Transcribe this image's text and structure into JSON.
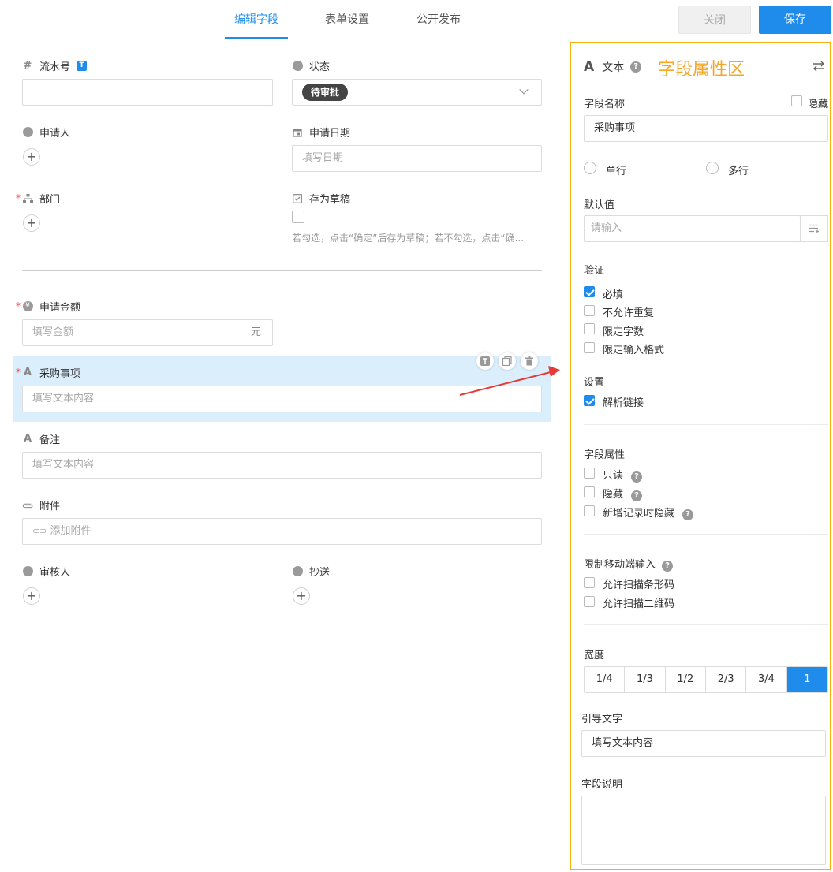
{
  "header": {
    "tabs": [
      "编辑字段",
      "表单设置",
      "公开发布"
    ],
    "close_label": "关闭",
    "save_label": "保存"
  },
  "form": {
    "serial": {
      "label": "流水号",
      "badge": "T"
    },
    "status": {
      "label": "状态",
      "value": "待审批"
    },
    "applicant": {
      "label": "申请人"
    },
    "apply_date": {
      "label": "申请日期",
      "placeholder": "填写日期"
    },
    "department": {
      "label": "部门"
    },
    "draft": {
      "label": "存为草稿",
      "hint": "若勾选，点击“确定”后存为草稿；若不勾选，点击“确..."
    },
    "amount": {
      "label": "申请金额",
      "placeholder": "填写金额",
      "unit": "元"
    },
    "purchase": {
      "label": "采购事项",
      "placeholder": "填写文本内容"
    },
    "remark": {
      "label": "备注",
      "placeholder": "填写文本内容"
    },
    "attachment": {
      "label": "附件",
      "placeholder": "添加附件"
    },
    "reviewer": {
      "label": "审核人"
    },
    "cc": {
      "label": "抄送"
    }
  },
  "panel": {
    "type_label": "文本",
    "annotation": "字段属性区",
    "field_name_label": "字段名称",
    "hide_label": "隐藏",
    "field_name_value": "采购事项",
    "single_line": "单行",
    "multi_line": "多行",
    "default_label": "默认值",
    "default_placeholder": "请输入",
    "validation_label": "验证",
    "validation": [
      {
        "label": "必填",
        "checked": true
      },
      {
        "label": "不允许重复",
        "checked": false
      },
      {
        "label": "限定字数",
        "checked": false
      },
      {
        "label": "限定输入格式",
        "checked": false
      }
    ],
    "settings_label": "设置",
    "parse_link": "解析链接",
    "field_props_label": "字段属性",
    "readonly": "只读",
    "hidden": "隐藏",
    "hide_on_new": "新增记录时隐藏",
    "mobile_label": "限制移动端输入",
    "scan_barcode": "允许扫描条形码",
    "scan_qrcode": "允许扫描二维码",
    "width_label": "宽度",
    "widths": [
      "1/4",
      "1/3",
      "1/2",
      "2/3",
      "3/4",
      "1"
    ],
    "guide_label": "引导文字",
    "guide_value": "填写文本内容",
    "desc_label": "字段说明"
  },
  "colors": {
    "accent": "#1f8ceb",
    "annotation": "#f5a623",
    "arrow": "#e53935"
  }
}
